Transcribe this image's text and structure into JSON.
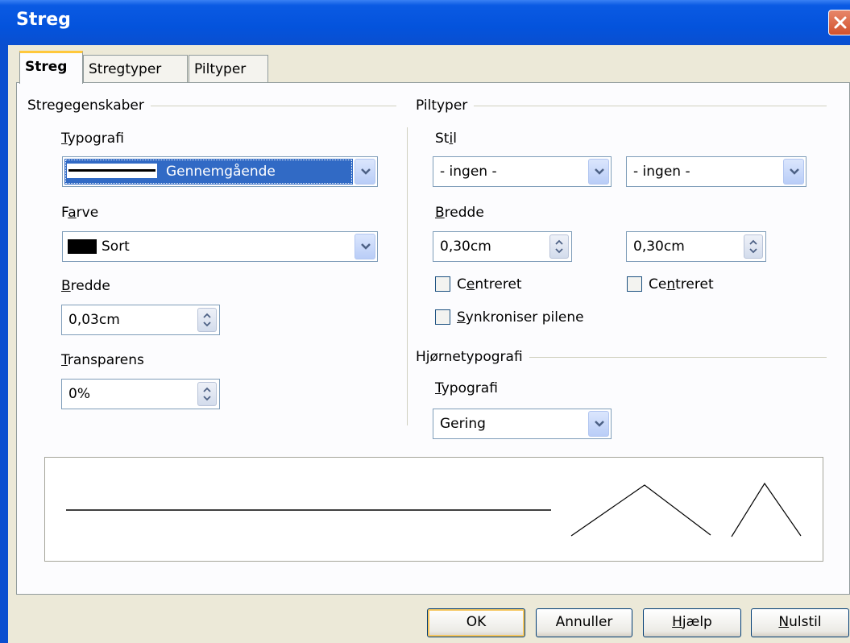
{
  "window": {
    "title": "Streg"
  },
  "tabs": [
    {
      "label": "Streg",
      "active": true
    },
    {
      "label": "Stregtyper",
      "active": false
    },
    {
      "label": "Piltyper",
      "active": false
    }
  ],
  "line_properties": {
    "header": "Stregegenskaber",
    "style_label": "Typografi",
    "style_value": "Gennemgående",
    "color_label": "Farve",
    "color_value": "Sort",
    "color_swatch": "#000000",
    "width_label": "Bredde",
    "width_value": "0,03cm",
    "transparency_label": "Transparens",
    "transparency_value": "0%"
  },
  "arrow_styles": {
    "header": "Piltyper",
    "style_label": "Stil",
    "start_style": "- ingen -",
    "end_style": "- ingen -",
    "width_label": "Bredde",
    "start_width": "0,30cm",
    "end_width": "0,30cm",
    "start_centered_label": "Centreret",
    "end_centered_label": "Centreret",
    "start_centered": false,
    "end_centered": false,
    "sync_label": "Synkroniser pilene",
    "sync_checked": false
  },
  "corner_style": {
    "header": "Hjørnetypografi",
    "style_label": "Typografi",
    "style_value": "Gering"
  },
  "buttons": {
    "ok": "OK",
    "cancel": "Annuller",
    "help": "Hjælp",
    "reset": "Nulstil"
  },
  "colors": {
    "titlebar": "#0453dc",
    "selection": "#316ac5",
    "accent_tab": "#ffc83c"
  }
}
